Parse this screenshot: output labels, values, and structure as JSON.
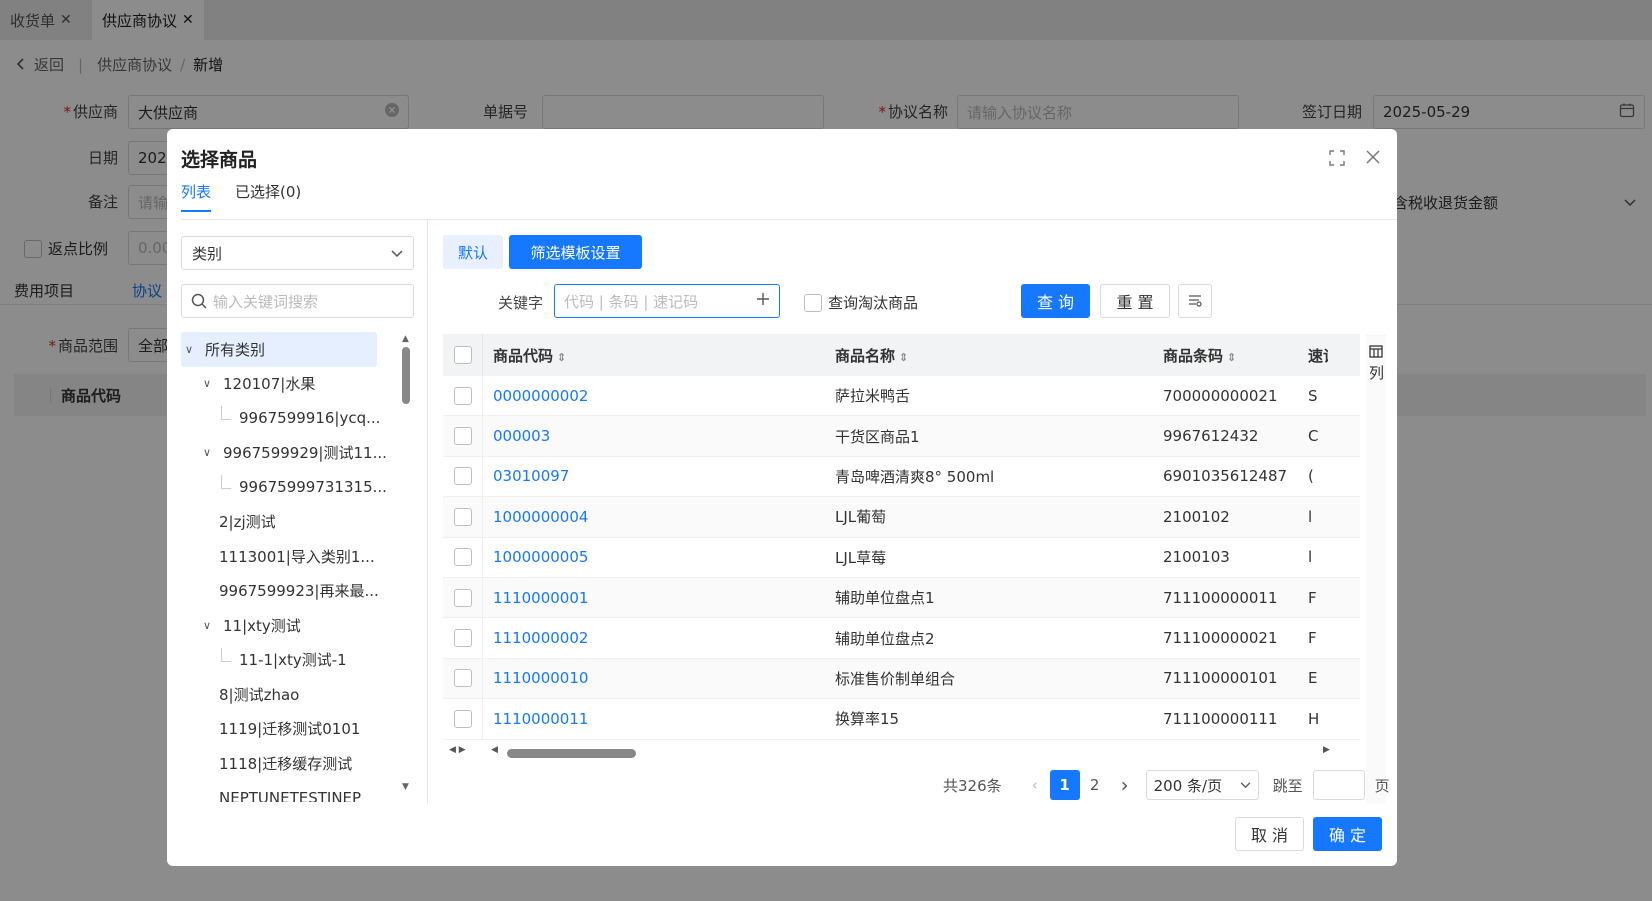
{
  "tabs": [
    {
      "label": "收货单",
      "close": "✕"
    },
    {
      "label": "供应商协议",
      "close": "✕"
    }
  ],
  "breadcrumb": {
    "back": "返回",
    "parent": "供应商协议",
    "sep": "/",
    "current": "新增"
  },
  "form": {
    "supplier_label": "供应商",
    "supplier_value": "大供应商",
    "doc_no_label": "单据号",
    "doc_no_value": "",
    "agreement_name_label": "协议名称",
    "agreement_name_placeholder": "请输入协议名称",
    "sign_date_label": "签订日期",
    "sign_date_value": "2025-05-29",
    "date_label": "日期",
    "date_value": "202",
    "remark_label": "备注",
    "remark_placeholder": "请输",
    "rebate_label": "返点比例",
    "rebate_value": "0.00",
    "right_select_value": "含税收退货金额",
    "product_range_label": "商品范围",
    "product_range_value": "全部"
  },
  "subtabs": [
    "费用项目",
    "协议"
  ],
  "bg_table": {
    "col1": "商品代码"
  },
  "modal": {
    "title": "选择商品",
    "tabs": [
      "列表",
      "已选择(0)"
    ],
    "category_select": "类别",
    "search_placeholder": "输入关键词搜索",
    "tree": [
      {
        "label": "所有类别",
        "level": 0,
        "expander": "∨",
        "root": true
      },
      {
        "label": "120107|水果",
        "level": 1,
        "expander": "∨"
      },
      {
        "label": "9967599916|ycq...",
        "level": 2,
        "expander": ""
      },
      {
        "label": "9967599929|测试11...",
        "level": 1,
        "expander": "∨"
      },
      {
        "label": "99675999731315...",
        "level": 2,
        "expander": ""
      },
      {
        "label": "2|zj测试",
        "level": 1,
        "expander": ""
      },
      {
        "label": "1113001|导入类别1...",
        "level": 1,
        "expander": ""
      },
      {
        "label": "9967599923|再来最...",
        "level": 1,
        "expander": ""
      },
      {
        "label": "11|xty测试",
        "level": 1,
        "expander": "∨"
      },
      {
        "label": "11-1|xty测试-1",
        "level": 2,
        "expander": ""
      },
      {
        "label": "8|测试zhao",
        "level": 1,
        "expander": ""
      },
      {
        "label": "1119|迁移测试0101",
        "level": 1,
        "expander": ""
      },
      {
        "label": "1118|迁移缓存测试",
        "level": 1,
        "expander": ""
      },
      {
        "label": "NEPTUNETESTINEP",
        "level": 1,
        "expander": ""
      }
    ],
    "filter": {
      "default_label": "默认",
      "template_label": "筛选模板设置",
      "keyword_label": "关键字",
      "keyword_placeholder": "代码 | 条码 | 速记码",
      "discontinued_label": "查询淘汰商品",
      "query_label": "查 询",
      "reset_label": "重 置"
    },
    "table": {
      "headers": [
        "商品代码",
        "商品名称",
        "商品条码",
        "速记"
      ],
      "col_setting": "列",
      "rows": [
        {
          "code": "0000000002",
          "name": "萨拉米鸭舌",
          "barcode": "700000000021",
          "short": "S"
        },
        {
          "code": "000003",
          "name": "干货区商品1",
          "barcode": "9967612432",
          "short": "C"
        },
        {
          "code": "03010097",
          "name": "青岛啤酒清爽8° 500ml",
          "barcode": "6901035612487",
          "short": "("
        },
        {
          "code": "1000000004",
          "name": "LJL葡萄",
          "barcode": "2100102",
          "short": "l"
        },
        {
          "code": "1000000005",
          "name": "LJL草莓",
          "barcode": "2100103",
          "short": "l"
        },
        {
          "code": "1110000001",
          "name": "辅助单位盘点1",
          "barcode": "711100000011",
          "short": "F"
        },
        {
          "code": "1110000002",
          "name": "辅助单位盘点2",
          "barcode": "711100000021",
          "short": "F"
        },
        {
          "code": "1110000010",
          "name": "标准售价制单组合",
          "barcode": "711100000101",
          "short": "E"
        },
        {
          "code": "1110000011",
          "name": "换算率15",
          "barcode": "711100000111",
          "short": "H"
        }
      ]
    },
    "pager": {
      "total": "共326条",
      "pages": [
        "1",
        "2"
      ],
      "page_size": "200 条/页",
      "jump_label": "跳至",
      "page_unit": "页"
    },
    "footer": {
      "cancel": "取 消",
      "confirm": "确 定"
    }
  },
  "colors": {
    "primary": "#1677ff",
    "required": "#e2231a"
  }
}
